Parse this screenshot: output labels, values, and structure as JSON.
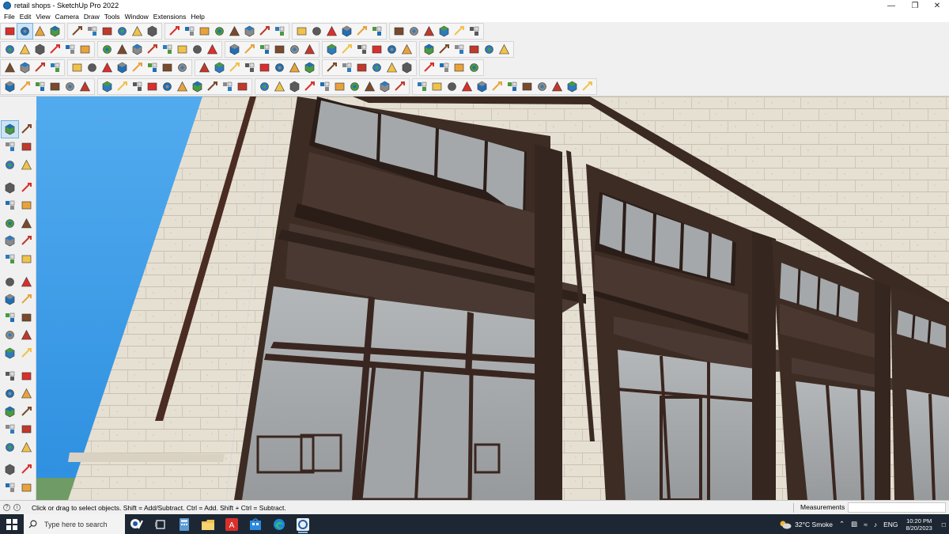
{
  "window": {
    "title": "retail shops - SketchUp Pro 2022",
    "controls": [
      "minimize",
      "maximize",
      "close"
    ]
  },
  "menu": [
    "File",
    "Edit",
    "View",
    "Camera",
    "Draw",
    "Tools",
    "Window",
    "Extensions",
    "Help"
  ],
  "toolbar_rows": [
    [
      "search-icon",
      "select-icon",
      "eraser-icon",
      "pencil-icon",
      "arc-icon",
      "rectangle-icon",
      "push-pull-icon",
      "follow-me-icon",
      "move-icon",
      "rotate-icon",
      "scale-icon",
      "tape-icon",
      "text-icon",
      "paint-icon",
      "orbit-icon",
      "zoom-icon",
      "zoom-extents-icon",
      "component-icon",
      "sandbox-icon",
      "layer-icon",
      "section-icon",
      "style-icon",
      "shadow-icon",
      "fog-icon",
      "match-photo-icon",
      "axes-icon",
      "guide-icon",
      "undo-icon",
      "redo-icon",
      "share-icon"
    ],
    [
      "iso-icon",
      "top-icon",
      "front-icon",
      "right-icon",
      "back-icon",
      "left-icon",
      "bottom-icon",
      "perspective-icon",
      "xray-icon",
      "back-edges-icon",
      "wireframe-icon",
      "hidden-line-icon",
      "shaded-icon",
      "textured-icon",
      "monochrome-icon",
      "house-icon",
      "layer-icon",
      "outliner-icon",
      "soften-icon",
      "smooth-icon",
      "join-icon",
      "extrude-icon",
      "tool-icon",
      "wrench-icon",
      "loop-icon",
      "ring-icon",
      "curve-icon",
      "shape-icon",
      "grid-icon",
      "flag-icon",
      "material-icon",
      "pin-icon"
    ],
    [
      "cube-icon",
      "cube-alt-icon",
      "sphere-icon",
      "plate-icon",
      "ring-icon",
      "gear-icon",
      "arrow-icon",
      "stair-icon",
      "chain-icon",
      "box-icon",
      "cone-icon",
      "pyramid-icon",
      "node-icon",
      "hinge-icon",
      "tube-icon",
      "panel-icon",
      "fence-icon",
      "window-icon",
      "roof-icon",
      "grid-icon",
      "slope-icon",
      "cloud-icon",
      "tree-icon",
      "mesh-icon",
      "flip-icon",
      "vertex-icon",
      "edge-icon",
      "face-icon",
      "group-icon",
      "wall-icon"
    ],
    [
      "line-icon",
      "freehand-icon",
      "offset-icon",
      "bezier-icon",
      "polyline-icon",
      "spiral-icon",
      "helix-icon",
      "wave-icon",
      "blob-icon",
      "curve-icon",
      "spline-icon",
      "fillet-icon",
      "chamfer-icon",
      "trim-icon",
      "extend-icon",
      "split-icon",
      "weld-icon",
      "explode-icon",
      "divide-icon",
      "project-icon",
      "drape-icon",
      "stamp-icon",
      "smoove-icon",
      "flip-edge-icon",
      "add-detail-icon",
      "terrain-icon",
      "contour-icon",
      "hatch-icon",
      "pattern-icon",
      "texture-icon",
      "tile-icon",
      "brick-icon",
      "shingle-icon",
      "stone-icon",
      "wood-icon",
      "metal-icon",
      "glass-icon",
      "fabric-icon"
    ]
  ],
  "left_tools": [
    [
      "select-icon",
      "orbit-icon"
    ],
    [
      "paint-icon",
      "eraser-icon"
    ],
    [
      "component-icon",
      "pencil-icon"
    ],
    [
      "line-icon",
      "freehand-icon"
    ],
    [
      "rectangle-icon",
      "rotated-rect-icon"
    ],
    [
      "circle-icon",
      "polygon-icon"
    ],
    [
      "arc-icon",
      "two-point-arc-icon"
    ],
    [
      "three-point-arc-icon",
      "pie-icon"
    ],
    [
      "move-icon",
      "push-pull-icon"
    ],
    [
      "rotate-icon",
      "follow-me-icon"
    ],
    [
      "scale-icon",
      "offset-icon"
    ],
    [
      "tape-icon",
      "dimension-icon"
    ],
    [
      "protractor-icon",
      "text-icon"
    ],
    [
      "axes-icon",
      "text-3d-icon"
    ],
    [
      "orbit-icon",
      "pan-icon"
    ],
    [
      "zoom-icon",
      "zoom-window-icon"
    ],
    [
      "zoom-extents-icon",
      "previous-view-icon"
    ],
    [
      "walk-icon",
      "look-around-icon"
    ],
    [
      "section-plane-icon",
      "position-camera-icon"
    ],
    [
      "sandbox-icon",
      "smoove-icon"
    ],
    [
      "stamp-icon",
      "drape-icon"
    ]
  ],
  "status": {
    "hint": "Click or drag to select objects. Shift = Add/Subtract. Ctrl = Add. Shift + Ctrl = Subtract.",
    "measurements_label": "Measurements",
    "measurements_value": ""
  },
  "taskbar": {
    "search_placeholder": "Type here to search",
    "apps": [
      "search-icon-app",
      "task-view-icon",
      "calculator-icon",
      "file-explorer-icon",
      "acrobat-icon",
      "store-icon",
      "edge-icon",
      "sketchup-icon"
    ],
    "weather": "32°C  Smoke",
    "language": "ENG",
    "time": "10:20 PM",
    "date": "8/20/2023"
  },
  "colors": {
    "sky": "#3fa0ea",
    "stone": "#e8e2d6",
    "dark_trim": "#3b2a22",
    "glass": "#a3a6a8",
    "taskbar": "#1d2733"
  }
}
